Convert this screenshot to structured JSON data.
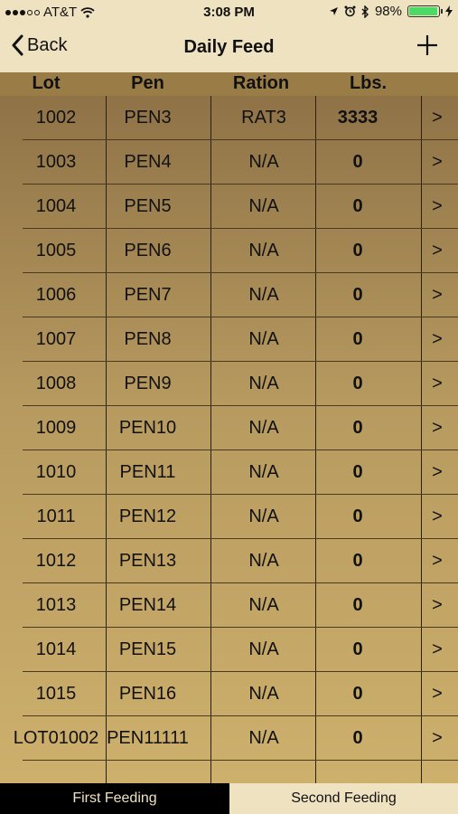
{
  "status_bar": {
    "carrier": "AT&T",
    "time": "3:08 PM",
    "battery_percent": "98%",
    "battery_level": 0.98,
    "icons": [
      "signal-dots-icon",
      "wifi-icon",
      "location-arrow-icon",
      "alarm-clock-icon",
      "bluetooth-icon",
      "battery-icon",
      "charging-bolt-icon"
    ]
  },
  "nav": {
    "back_label": "Back",
    "title": "Daily Feed",
    "add_icon": "plus-icon"
  },
  "table": {
    "headers": {
      "lot": "Lot",
      "pen": "Pen",
      "ration": "Ration",
      "lbs": "Lbs."
    },
    "chevron": ">",
    "rows": [
      {
        "lot": "1002",
        "pen": "PEN3",
        "ration": "RAT3",
        "lbs": "3333"
      },
      {
        "lot": "1003",
        "pen": "PEN4",
        "ration": "N/A",
        "lbs": "0"
      },
      {
        "lot": "1004",
        "pen": "PEN5",
        "ration": "N/A",
        "lbs": "0"
      },
      {
        "lot": "1005",
        "pen": "PEN6",
        "ration": "N/A",
        "lbs": "0"
      },
      {
        "lot": "1006",
        "pen": "PEN7",
        "ration": "N/A",
        "lbs": "0"
      },
      {
        "lot": "1007",
        "pen": "PEN8",
        "ration": "N/A",
        "lbs": "0"
      },
      {
        "lot": "1008",
        "pen": "PEN9",
        "ration": "N/A",
        "lbs": "0"
      },
      {
        "lot": "1009",
        "pen": "PEN10",
        "ration": "N/A",
        "lbs": "0"
      },
      {
        "lot": "1010",
        "pen": "PEN11",
        "ration": "N/A",
        "lbs": "0"
      },
      {
        "lot": "1011",
        "pen": "PEN12",
        "ration": "N/A",
        "lbs": "0"
      },
      {
        "lot": "1012",
        "pen": "PEN13",
        "ration": "N/A",
        "lbs": "0"
      },
      {
        "lot": "1013",
        "pen": "PEN14",
        "ration": "N/A",
        "lbs": "0"
      },
      {
        "lot": "1014",
        "pen": "PEN15",
        "ration": "N/A",
        "lbs": "0"
      },
      {
        "lot": "1015",
        "pen": "PEN16",
        "ration": "N/A",
        "lbs": "0"
      },
      {
        "lot": "LOT01002",
        "pen": "PEN11111",
        "ration": "N/A",
        "lbs": "0"
      }
    ]
  },
  "tabs": {
    "first": "First Feeding",
    "second": "Second Feeding",
    "active": "first"
  },
  "colors": {
    "nav_background": "#efe2c1",
    "header_background": "#9a7c47",
    "active_tab_background": "#000000",
    "battery_fill": "#4cd964"
  }
}
